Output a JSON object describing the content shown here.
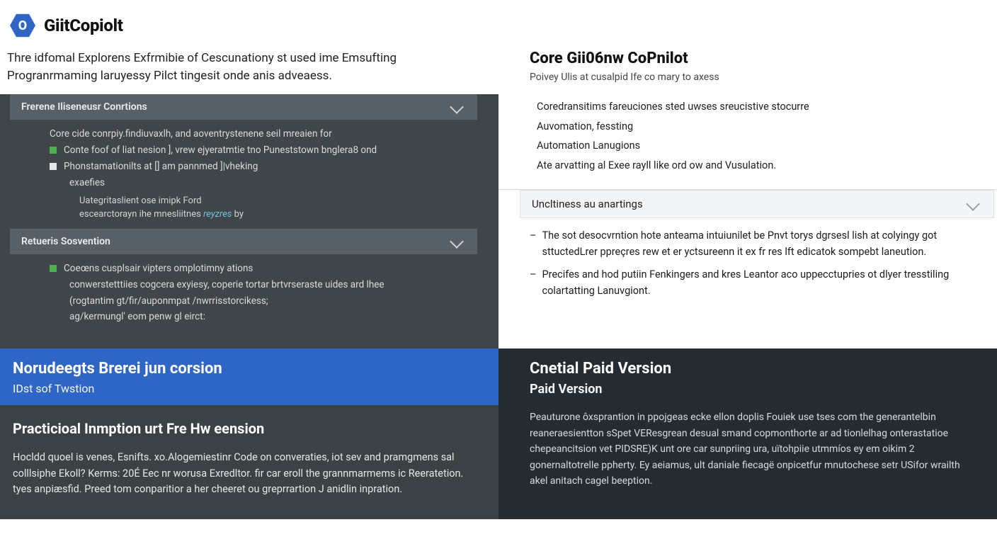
{
  "header": {
    "logo_letter": "O",
    "brand": "GiitCopiolt"
  },
  "intro": "Thre idfomal Explorens Exfrmibie of Cescunationy st used ime Emsufting Progranrmaming laruyessy Pilct tingesit onde anis adveaess.",
  "right_top": {
    "title": "Core Gii06nw CoPnilot",
    "subtitle": "Poivey Ulis at cusalpid Ife co mary to axess",
    "features": [
      "Coredransitims fareuciones sted uwses sreucistive stocurre",
      "Auvomation, fessting",
      "Automation Lanugions",
      "Ate arvatting al Exee rayll like ord ow and Vusulation."
    ]
  },
  "tree": {
    "section1": {
      "title": "Frerene Iliseneusr Conrtions",
      "lines": [
        "Core cide conrpiy.findiuvaxlh, and aoventrystenene seil mreaien for",
        "Conte foof of liat nesion ], vrew ejyeratmtie tno Puneststown bnglera8 ond",
        "Phonstamationilts at [] am pannmed ]|vheking",
        "exaefies"
      ],
      "sub": "Uategritaslient ose imipk Ford escearctorayn ihe mnesliitnes reyzres by"
    },
    "section2": {
      "title": "Retueris Sosvention",
      "lines": [
        "Coeœns cusplsair vipters omplotimny ations",
        "conwerstetttiies cogcera exyiesy, coperie tortar brtvrseraste uides ard lhee",
        "(rogtantim gt/fir/auponmpat /nwrrisstorcikess;",
        "ag/kermungl' eom penw gl eirct:"
      ]
    }
  },
  "accordion": {
    "title": "Uncltiness au anartings",
    "items": [
      "The sot desocvrntion hote anteama intuiunilet be Pnvt torys dgrsesl lish at colyingy got sttuctedLrer ppreçres rew et er yctsureenn it ex fr res lft edicatok sompebt laneution.",
      "Precifes and hod putiin Fenkingers and kres Leantor aco uppecctupries ot dlyer tresstiling colartatting Lanuvgiont."
    ]
  },
  "lower_left": {
    "head_title": "Norudeegts Brerei jun corsion",
    "head_sub": "IDst sof Twstion",
    "body_title": "Practicioal Inmption urt Fre Hw eension",
    "body_text": "Hocldd quoel is venes, Esnifts. xo.Alogemiestinr Code on converaties, iot sev and pramgmens sal colllsiphe Ekoll? Kerms: 20É Eec nr worusa Exredltor. fir car eroll the grannmarmems ic Reeratetion. tyes anpiæsfid. Preed tom conparitior a her cheeret ou greprrartion J anidlin inpration."
  },
  "lower_right": {
    "title": "Cnetial Paid Version",
    "sub": "Paid Version",
    "text": "Peauturone ôxsprantion in ppojgeas ecke ellon doplis Fouiek use tses com the generantelbin reaneraesientton sSpet VEResgrean desual smand copmonthorte ar ad tionlelhag onterastatioe chepeancitsion vet PIDSRE)K unt ore car sunpriing ura, uïtohpiie utmmíos ey em oikim 2 gonernaltotrelle ppherty. Ey aeiamus, ult daniale fiecagë onpicetfur mnutochese setr USifor wrailth akel anitach cagel beeption."
  }
}
